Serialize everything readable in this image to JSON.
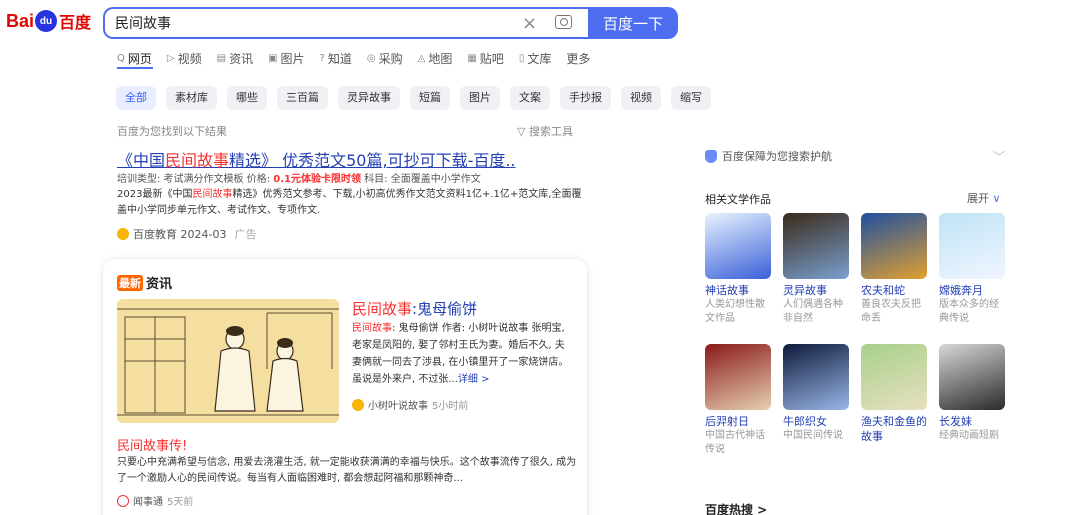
{
  "logo": {
    "bai": "Bai",
    "paw": "du",
    "cn": "百度"
  },
  "search": {
    "value": "民间故事",
    "button_label": "百度一下",
    "clear": "×"
  },
  "tabs": [
    {
      "label": "网页",
      "icon": "search-icon",
      "glyph": "Q"
    },
    {
      "label": "视频",
      "icon": "video-icon",
      "glyph": "▷"
    },
    {
      "label": "资讯",
      "icon": "news-icon",
      "glyph": "▤"
    },
    {
      "label": "图片",
      "icon": "image-icon",
      "glyph": "▣"
    },
    {
      "label": "知道",
      "icon": "question-icon",
      "glyph": "?"
    },
    {
      "label": "采购",
      "icon": "purchase-icon",
      "glyph": "◎"
    },
    {
      "label": "地图",
      "icon": "map-icon",
      "glyph": "◬"
    },
    {
      "label": "贴吧",
      "icon": "tieba-icon",
      "glyph": "▦"
    },
    {
      "label": "文库",
      "icon": "library-icon",
      "glyph": "▯"
    },
    {
      "label": "更多",
      "icon": "",
      "glyph": ""
    }
  ],
  "chips": [
    "全部",
    "素材库",
    "哪些",
    "三百篇",
    "灵异故事",
    "短篇",
    "图片",
    "文案",
    "手抄报",
    "视频",
    "缩写"
  ],
  "found_text": "百度为您找到以下结果",
  "search_tools": "搜索工具",
  "ad": {
    "title_pre": "《中国",
    "title_hl": "民间故事",
    "title_post": "精选》 优秀范文50篇,可抄可下载-百度..",
    "meta_pre": "培训类型: 考试满分作文模板   价格: ",
    "meta_price": "0.1元体验卡限时领",
    "meta_post": "   科目: 全面覆盖中小学作文",
    "desc_pre": "2023最新《中国",
    "desc_hl": "民间故事",
    "desc_post": "精选》优秀范文参考、下载,小初高优秀作文范文资料1亿+.1亿+范文库,全面覆盖中小学同步单元作文、考试作文、专项作文.",
    "source": "百度教育 2024-03",
    "ad_label": "广告"
  },
  "news": {
    "badge": "最新",
    "header": "资讯",
    "title_hl": "民间故事",
    "title_post": ":鬼母偷饼",
    "desc_hl": "民间故事",
    "desc_post": ": 鬼母偷饼 作者: 小树叶说故事 张明宝, 老家是凤阳的, 娶了邻村王氏为妻。婚后不久, 夫妻俩就一同去了涉县, 在小镇里开了一家烧饼店。虽说是外来户, 不过张...",
    "more": "详细 >",
    "source": "小树叶说故事",
    "time": "5小时前",
    "title2": "民间故事传!",
    "desc2": "只要心中充满希望与信念, 用爱去浇灌生活, 就一定能收获满满的幸福与快乐。这个故事流传了很久, 成为了一个激励人心的民间传说。每当有人面临困难时, 都会想起阿福和那颗神奇...",
    "source2": "闻事通",
    "time2": "5天前"
  },
  "right": {
    "protect": "百度保障为您搜索护航",
    "related_title": "相关文学作品",
    "expand": "展开",
    "works": [
      {
        "name": "神话故事",
        "desc": "人类幻想性散文作品",
        "c1": "#e8f4ff",
        "c2": "#3a5fd8"
      },
      {
        "name": "灵异故事",
        "desc": "人们偶遇各种非自然",
        "c1": "#3a2a1a",
        "c2": "#7aa0d0"
      },
      {
        "name": "农夫和蛇",
        "desc": "善良农夫反把命丢",
        "c1": "#1f4fa0",
        "c2": "#e0a030"
      },
      {
        "name": "嫦娥奔月",
        "desc": "版本众多的经典传说",
        "c1": "#bfe3f5",
        "c2": "#f0f6ff"
      },
      {
        "name": "后羿射日",
        "desc": "中国古代神话传说",
        "c1": "#8a1a1a",
        "c2": "#e6d0b0"
      },
      {
        "name": "牛郎织女",
        "desc": "中国民间传说",
        "c1": "#0e1b3a",
        "c2": "#9ab6e8"
      },
      {
        "name": "渔夫和金鱼的故事",
        "desc": "",
        "c1": "#a7d08a",
        "c2": "#e8e0c0"
      },
      {
        "name": "长发妹",
        "desc": "经典动画短剧",
        "c1": "#d8d8d8",
        "c2": "#2a2a2a"
      }
    ],
    "hot": "百度热搜 >"
  }
}
